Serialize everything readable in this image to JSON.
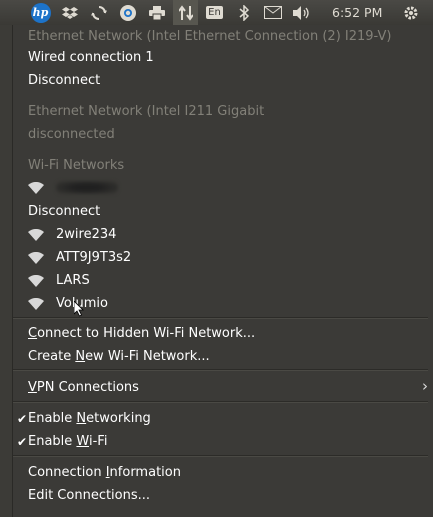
{
  "panel": {
    "icons": [
      "hp-logo-icon",
      "dropbox-icon",
      "sync-icon",
      "chrome-icon",
      "printer-icon",
      "network-arrows-icon",
      "keyboard-layout-icon",
      "bluetooth-icon",
      "mail-icon",
      "volume-icon",
      "clock",
      "gear-icon"
    ],
    "hp_logo": "hp",
    "keyboard_layout": "En",
    "clock": "6:52 PM"
  },
  "menu": {
    "wired1": {
      "header": "Ethernet Network (Intel Ethernet Connection (2) I219-V)",
      "connection": "Wired connection 1",
      "disconnect": "Disconnect"
    },
    "wired2": {
      "header": "Ethernet Network (Intel I211 Gigabit",
      "status": "disconnected"
    },
    "wifi": {
      "header": "Wi-Fi Networks",
      "connected_ssid_blurred": true,
      "disconnect": "Disconnect",
      "networks": [
        "2wire234",
        "ATT9J9T3s2",
        "LARS",
        "Volumio"
      ]
    },
    "actions": {
      "connect_hidden": {
        "pre": "",
        "u": "C",
        "post": "onnect to Hidden Wi-Fi Network..."
      },
      "create_new": {
        "pre": "Create ",
        "u": "N",
        "post": "ew Wi-Fi Network..."
      },
      "vpn": {
        "pre": "",
        "u": "V",
        "post": "PN Connections"
      },
      "enable_networking": {
        "pre": "Enable ",
        "u": "N",
        "post": "etworking",
        "checked": true
      },
      "enable_wifi": {
        "pre": "Enable ",
        "u": "W",
        "post": "i-Fi",
        "checked": true
      },
      "connection_info": {
        "pre": "Connection ",
        "u": "I",
        "post": "nformation"
      },
      "edit_connections": "Edit Connections..."
    }
  },
  "colors": {
    "menu_bg": "#3b3a37",
    "header_text": "#828078",
    "item_text": "#ffffff"
  }
}
